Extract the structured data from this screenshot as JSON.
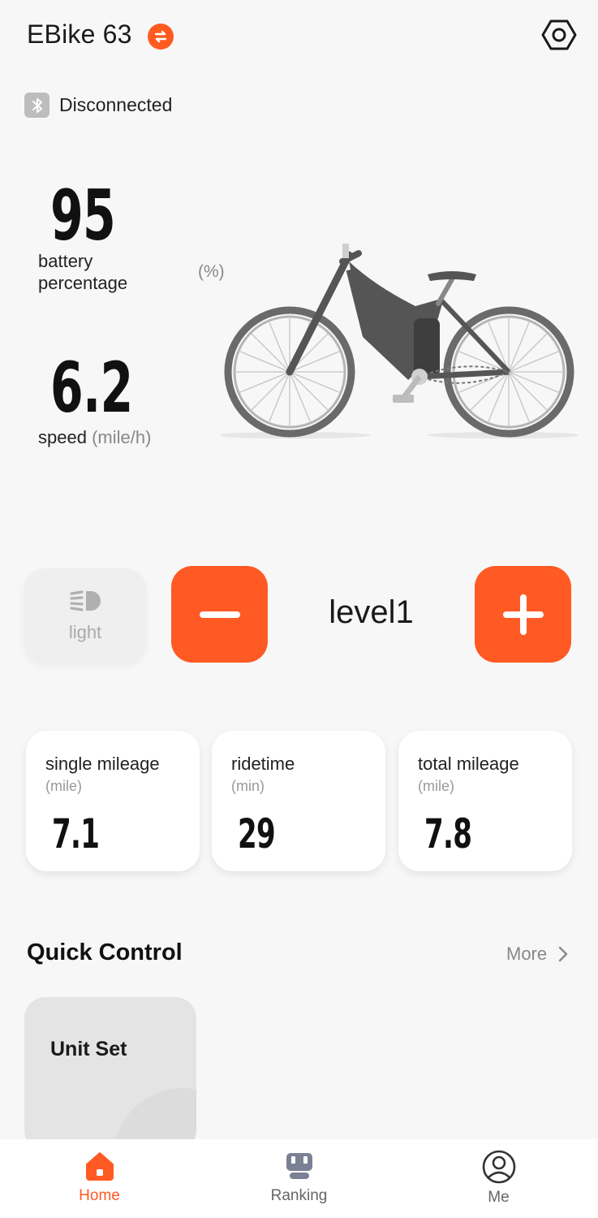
{
  "header": {
    "title": "EBike 63",
    "swap_icon": "swap-icon",
    "settings_icon": "hexagon-settings-icon"
  },
  "connection": {
    "status": "Disconnected",
    "icon": "bluetooth-icon"
  },
  "battery": {
    "value": "95",
    "label": "battery\npercentage",
    "unit": "(%)"
  },
  "speed": {
    "value": "6.2",
    "label": "speed",
    "unit": "(mile/h)"
  },
  "controls": {
    "light_label": "light",
    "level": "level1"
  },
  "stats": [
    {
      "label": "single mileage",
      "unit": "(mile)",
      "value": "7.1"
    },
    {
      "label": "ridetime",
      "unit": "(min)",
      "value": "29"
    },
    {
      "label": "total mileage",
      "unit": "(mile)",
      "value": "7.8"
    }
  ],
  "quick_control": {
    "title": "Quick Control",
    "more": "More",
    "items": [
      {
        "label": "Unit Set"
      }
    ]
  },
  "nav": {
    "items": [
      {
        "label": "Home",
        "icon": "home-icon",
        "active": true
      },
      {
        "label": "Ranking",
        "icon": "ranking-icon",
        "active": false
      },
      {
        "label": "Me",
        "icon": "profile-icon",
        "active": false
      }
    ]
  },
  "colors": {
    "accent": "#ff5a24",
    "background": "#f7f7f7",
    "muted": "#888888"
  }
}
